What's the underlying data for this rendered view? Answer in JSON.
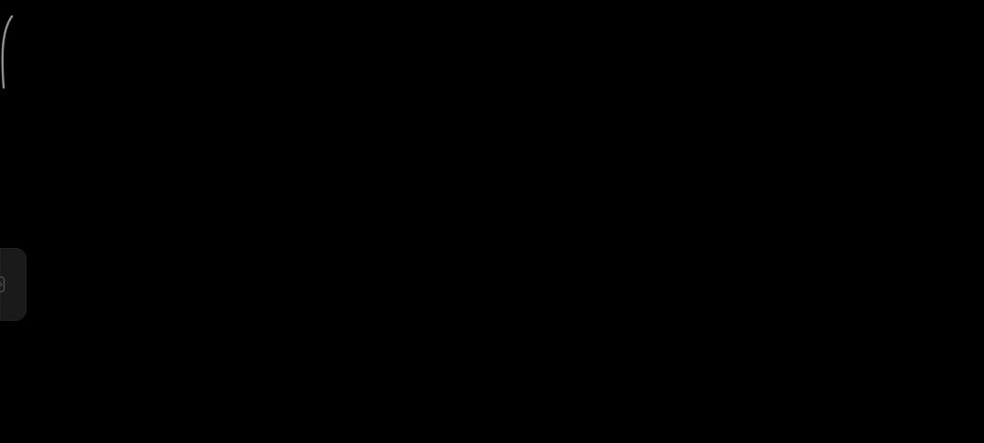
{
  "screen": {
    "background": "#000000",
    "content_state": "blank-dark"
  },
  "edge_gesture": {
    "icon": "back-gesture-arc-icon",
    "color": "#8a8a8a"
  },
  "side_tab": {
    "icon": "side-panel-icon",
    "background": "#1a1a1a",
    "icon_color": "#4a4a4a"
  }
}
